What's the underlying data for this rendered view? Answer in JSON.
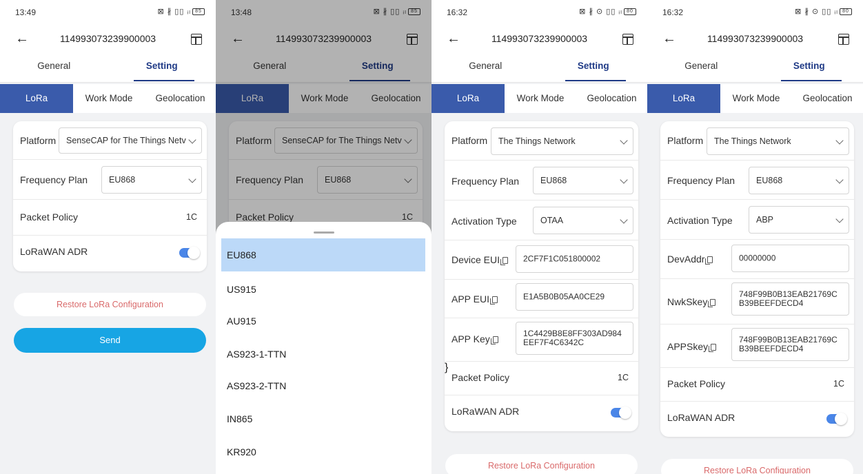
{
  "phones": [
    {
      "time": "13:49",
      "status_icons": "⊠ ∦ ▯▯ ᵢₗ",
      "battery": "85",
      "device_id": "114993073239900003",
      "tabs": {
        "general": "General",
        "setting": "Setting"
      },
      "subtabs": {
        "lora": "LoRa",
        "work": "Work Mode",
        "geo": "Geolocation"
      },
      "platform_label": "Platform",
      "platform_value": "SenseCAP for The Things Netv",
      "freq_label": "Frequency Plan",
      "freq_value": "EU868",
      "packet_label": "Packet Policy",
      "packet_value": "1C",
      "adr_label": "LoRaWAN ADR",
      "restore_label": "Restore LoRa Configuration",
      "send_label": "Send"
    },
    {
      "time": "13:48",
      "status_icons": "⊠ ∦ ▯▯ ᵢₗ",
      "battery": "85",
      "device_id": "114993073239900003",
      "tabs": {
        "general": "General",
        "setting": "Setting"
      },
      "subtabs": {
        "lora": "LoRa",
        "work": "Work Mode",
        "geo": "Geolocation"
      },
      "platform_label": "Platform",
      "platform_value": "SenseCAP for The Things Netv",
      "freq_label": "Frequency Plan",
      "freq_value": "EU868",
      "packet_label": "Packet Policy",
      "packet_value": "1C",
      "sheet_options": [
        "EU868",
        "US915",
        "AU915",
        "AS923-1-TTN",
        "AS923-2-TTN",
        "IN865",
        "KR920"
      ],
      "sheet_selected": "EU868"
    },
    {
      "time": "16:32",
      "status_icons": "⊠ ∦ ⊙ ▯▯ ᵢₗ",
      "battery": "80",
      "device_id": "114993073239900003",
      "tabs": {
        "general": "General",
        "setting": "Setting"
      },
      "subtabs": {
        "lora": "LoRa",
        "work": "Work Mode",
        "geo": "Geolocation"
      },
      "platform_label": "Platform",
      "platform_value": "The Things Network",
      "freq_label": "Frequency Plan",
      "freq_value": "EU868",
      "activation_label": "Activation Type",
      "activation_value": "OTAA",
      "device_eui_label": "Device EUI",
      "device_eui_value": "2CF7F1C051800002",
      "app_eui_label": "APP EUI",
      "app_eui_value": "E1A5B0B05AA0CE29",
      "app_key_label": "APP Key",
      "app_key_value_1": "1C4429B8E8FF303AD984",
      "app_key_value_2": "EEF7F4C6342C",
      "packet_label": "Packet Policy",
      "packet_value": "1C",
      "adr_label": "LoRaWAN ADR",
      "restore_label": "Restore LoRa Configuration"
    },
    {
      "time": "16:32",
      "status_icons": "⊠ ∦ ⊙ ▯▯ ᵢₗ",
      "battery": "80",
      "device_id": "114993073239900003",
      "tabs": {
        "general": "General",
        "setting": "Setting"
      },
      "subtabs": {
        "lora": "LoRa",
        "work": "Work Mode",
        "geo": "Geolocation"
      },
      "platform_label": "Platform",
      "platform_value": "The Things Network",
      "freq_label": "Frequency Plan",
      "freq_value": "EU868",
      "activation_label": "Activation Type",
      "activation_value": "ABP",
      "devaddr_label": "DevAddr",
      "devaddr_value": "00000000",
      "nwkskey_label": "NwkSkey",
      "nwkskey_value_1": "748F99B0B13EAB21769C",
      "nwkskey_value_2": "B39BEEFDECD4",
      "appskey_label": "APPSkey",
      "appskey_value_1": "748F99B0B13EAB21769C",
      "appskey_value_2": "B39BEEFDECD4",
      "packet_label": "Packet Policy",
      "packet_value": "1C",
      "adr_label": "LoRaWAN ADR",
      "restore_label": "Restore LoRa Configuration"
    }
  ],
  "colors": {
    "lora_tab_bg": "#3a5bab",
    "setting_accent": "#1f3a86",
    "send_button": "#17a5e4",
    "restore_text": "#d9696a",
    "toggle_on": "#4a86e8",
    "sheet_selected_bg": "#bcd9f8"
  }
}
